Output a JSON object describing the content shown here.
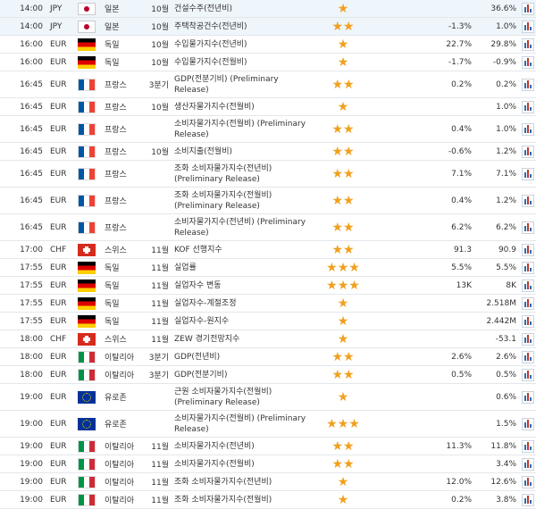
{
  "colors": {
    "star": "#f0a01e",
    "row_alt": "#eef5fb"
  },
  "events": [
    {
      "time": "14:00",
      "currency": "JPY",
      "flag": "jp",
      "country": "일본",
      "period": "10월",
      "name": "건설수주(전년비)",
      "importance": 1,
      "actual": "",
      "forecast": "",
      "previous": "36.6%"
    },
    {
      "time": "14:00",
      "currency": "JPY",
      "flag": "jp",
      "country": "일본",
      "period": "10월",
      "name": "주택착공건수(전년비)",
      "importance": 2,
      "actual": "",
      "forecast": "-1.3%",
      "previous": "1.0%"
    },
    {
      "time": "16:00",
      "currency": "EUR",
      "flag": "de",
      "country": "독일",
      "period": "10월",
      "name": "수입물가지수(전년비)",
      "importance": 1,
      "actual": "",
      "forecast": "22.7%",
      "previous": "29.8%"
    },
    {
      "time": "16:00",
      "currency": "EUR",
      "flag": "de",
      "country": "독일",
      "period": "10월",
      "name": "수입물가지수(전월비)",
      "importance": 1,
      "actual": "",
      "forecast": "-1.7%",
      "previous": "-0.9%"
    },
    {
      "time": "16:45",
      "currency": "EUR",
      "flag": "fr",
      "country": "프랑스",
      "period": "3분기",
      "name": "GDP(전분기비) (Preliminary Release)",
      "importance": 2,
      "actual": "",
      "forecast": "0.2%",
      "previous": "0.2%"
    },
    {
      "time": "16:45",
      "currency": "EUR",
      "flag": "fr",
      "country": "프랑스",
      "period": "10월",
      "name": "생산자물가지수(전월비)",
      "importance": 1,
      "actual": "",
      "forecast": "",
      "previous": "1.0%"
    },
    {
      "time": "16:45",
      "currency": "EUR",
      "flag": "fr",
      "country": "프랑스",
      "period": "",
      "name": "소비자물가지수(전월비) (Preliminary Release)",
      "importance": 2,
      "actual": "",
      "forecast": "0.4%",
      "previous": "1.0%"
    },
    {
      "time": "16:45",
      "currency": "EUR",
      "flag": "fr",
      "country": "프랑스",
      "period": "10월",
      "name": "소비지출(전월비)",
      "importance": 2,
      "actual": "",
      "forecast": "-0.6%",
      "previous": "1.2%"
    },
    {
      "time": "16:45",
      "currency": "EUR",
      "flag": "fr",
      "country": "프랑스",
      "period": "",
      "name": "조화 소비자물가지수(전년비) (Preliminary Release)",
      "importance": 2,
      "actual": "",
      "forecast": "7.1%",
      "previous": "7.1%"
    },
    {
      "time": "16:45",
      "currency": "EUR",
      "flag": "fr",
      "country": "프랑스",
      "period": "",
      "name": "조화 소비자물가지수(전월비) (Preliminary Release)",
      "importance": 2,
      "actual": "",
      "forecast": "0.4%",
      "previous": "1.2%"
    },
    {
      "time": "16:45",
      "currency": "EUR",
      "flag": "fr",
      "country": "프랑스",
      "period": "",
      "name": "소비자물가지수(전년비) (Preliminary Release)",
      "importance": 2,
      "actual": "",
      "forecast": "6.2%",
      "previous": "6.2%"
    },
    {
      "time": "17:00",
      "currency": "CHF",
      "flag": "ch",
      "country": "스위스",
      "period": "11월",
      "name": "KOF 선행지수",
      "importance": 2,
      "actual": "",
      "forecast": "91.3",
      "previous": "90.9"
    },
    {
      "time": "17:55",
      "currency": "EUR",
      "flag": "de",
      "country": "독일",
      "period": "11월",
      "name": "실업률",
      "importance": 3,
      "actual": "",
      "forecast": "5.5%",
      "previous": "5.5%"
    },
    {
      "time": "17:55",
      "currency": "EUR",
      "flag": "de",
      "country": "독일",
      "period": "11월",
      "name": "실업자수 변동",
      "importance": 3,
      "actual": "",
      "forecast": "13K",
      "previous": "8K"
    },
    {
      "time": "17:55",
      "currency": "EUR",
      "flag": "de",
      "country": "독일",
      "period": "11월",
      "name": "실업자수-계절조정",
      "importance": 1,
      "actual": "",
      "forecast": "",
      "previous": "2.518M"
    },
    {
      "time": "17:55",
      "currency": "EUR",
      "flag": "de",
      "country": "독일",
      "period": "11월",
      "name": "실업자수-원지수",
      "importance": 1,
      "actual": "",
      "forecast": "",
      "previous": "2.442M"
    },
    {
      "time": "18:00",
      "currency": "CHF",
      "flag": "ch",
      "country": "스위스",
      "period": "11월",
      "name": "ZEW 경기전망지수",
      "importance": 1,
      "actual": "",
      "forecast": "",
      "previous": "-53.1"
    },
    {
      "time": "18:00",
      "currency": "EUR",
      "flag": "it",
      "country": "이탈리아",
      "period": "3분기",
      "name": "GDP(전년비)",
      "importance": 2,
      "actual": "",
      "forecast": "2.6%",
      "previous": "2.6%"
    },
    {
      "time": "18:00",
      "currency": "EUR",
      "flag": "it",
      "country": "이탈리아",
      "period": "3분기",
      "name": "GDP(전분기비)",
      "importance": 2,
      "actual": "",
      "forecast": "0.5%",
      "previous": "0.5%"
    },
    {
      "time": "19:00",
      "currency": "EUR",
      "flag": "eu",
      "country": "유로존",
      "period": "",
      "name": "근원 소비자물가지수(전월비) (Preliminary Release)",
      "importance": 1,
      "actual": "",
      "forecast": "",
      "previous": "0.6%"
    },
    {
      "time": "19:00",
      "currency": "EUR",
      "flag": "eu",
      "country": "유로존",
      "period": "",
      "name": "소비자물가지수(전월비) (Preliminary Release)",
      "importance": 3,
      "actual": "",
      "forecast": "",
      "previous": "1.5%"
    },
    {
      "time": "19:00",
      "currency": "EUR",
      "flag": "it",
      "country": "이탈리아",
      "period": "11월",
      "name": "소비자물가지수(전년비)",
      "importance": 2,
      "actual": "",
      "forecast": "11.3%",
      "previous": "11.8%"
    },
    {
      "time": "19:00",
      "currency": "EUR",
      "flag": "it",
      "country": "이탈리아",
      "period": "11월",
      "name": "소비자물가지수(전월비)",
      "importance": 2,
      "actual": "",
      "forecast": "",
      "previous": "3.4%"
    },
    {
      "time": "19:00",
      "currency": "EUR",
      "flag": "it",
      "country": "이탈리아",
      "period": "11월",
      "name": "조화 소비자물가지수(전년비)",
      "importance": 1,
      "actual": "",
      "forecast": "12.0%",
      "previous": "12.6%"
    },
    {
      "time": "19:00",
      "currency": "EUR",
      "flag": "it",
      "country": "이탈리아",
      "period": "11월",
      "name": "조화 소비자물가지수(전월비)",
      "importance": 1,
      "actual": "",
      "forecast": "0.2%",
      "previous": "3.8%"
    }
  ]
}
